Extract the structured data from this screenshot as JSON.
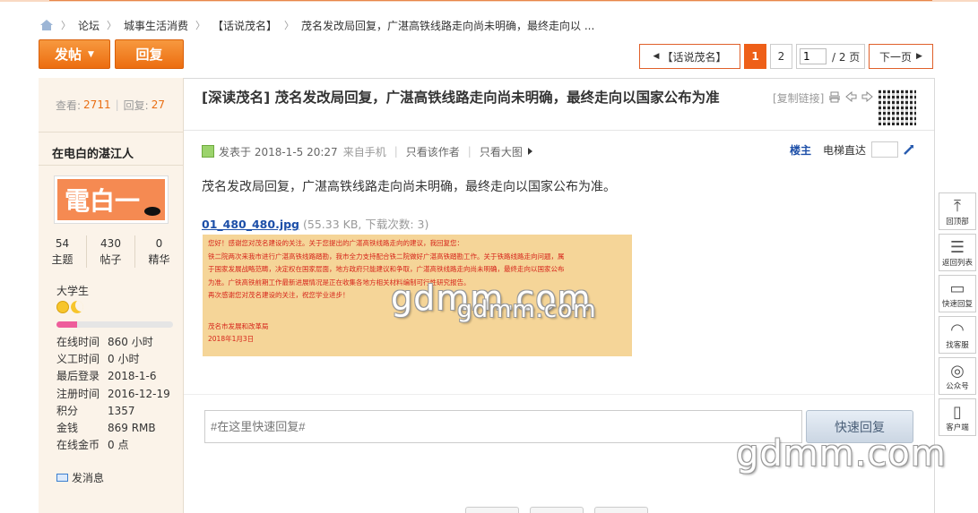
{
  "breadcrumb": {
    "items": [
      "论坛",
      "城事生活消费",
      "【话说茂名】",
      "茂名发改局回复，广湛高铁线路走向尚未明确，最终走向以 ..."
    ]
  },
  "actions": {
    "post": "发帖",
    "reply": "回复"
  },
  "pager": {
    "back": "【话说茂名】",
    "pages": [
      "1",
      "2"
    ],
    "current": "1",
    "input_value": "1",
    "total": "/ 2 页",
    "next": "下一页"
  },
  "thread": {
    "views_label": "查看:",
    "views": "2711",
    "replies_label": "回复:",
    "replies": "27",
    "title": "[深读茂名] 茂名发改局回复，广湛高铁线路走向尚未明确，最终走向以国家公布为准",
    "copy_link": "[复制链接]"
  },
  "author": {
    "name": "在电白的湛江人",
    "avatar_text": "電白一",
    "counts": [
      {
        "value": "54",
        "label": "主题"
      },
      {
        "value": "430",
        "label": "帖子"
      },
      {
        "value": "0",
        "label": "精华"
      }
    ],
    "rank": "大学生",
    "level_progress": 0.18,
    "info": [
      {
        "k": "在线时间",
        "v": "860 小时"
      },
      {
        "k": "义工时间",
        "v": "0 小时"
      },
      {
        "k": "最后登录",
        "v": "2018-1-6"
      },
      {
        "k": "注册时间",
        "v": "2016-12-19"
      },
      {
        "k": "积分",
        "v": "1357"
      },
      {
        "k": "金钱",
        "v": "869 RMB"
      },
      {
        "k": "在线金币",
        "v": "0 点"
      }
    ],
    "send_message": "发消息"
  },
  "post": {
    "posted": "发表于 2018-1-5 20:27",
    "source": "来自手机",
    "only_author": "只看该作者",
    "only_big": "只看大图",
    "floor": "楼主",
    "elevator": "电梯直达",
    "content": "茂名发改局回复，广湛高铁线路走向尚未明确，最终走向以国家公布为准。",
    "attachment_name": "01_480_480.jpg",
    "attachment_meta": "(55.33 KB, 下载次数: 3)",
    "image_lines": [
      "您好！感谢您对茂名建设的关注。关于您提出的广湛高铁线路走向的建议，我回复您：",
      "铁二院两次来我市进行广湛高铁线路踏勘，我市全力支持配合铁二院做好广湛高铁踏勘工作。关于铁路线路走向问题，属",
      "于国家发展战略范畴，决定权在国家层面，地方政府只能建议和争取，广湛高铁线路走向尚未明确，最终走向以国家公布",
      "为准。广铁高铁前期工作最新进展情况是正在收集各地方相关材料编制可行性研究报告。",
      "再次感谢您对茂名建设的关注，祝您学业进步！"
    ],
    "image_sig": "茂名市发展和改革局",
    "image_date": "2018年1月3日",
    "watermark": "gdmm.com"
  },
  "quick_reply": {
    "placeholder": "#在这里快速回复#",
    "button": "快速回复"
  },
  "side_toolbar": [
    {
      "label": "回顶部",
      "icon": "arrow-up-icon"
    },
    {
      "label": "返回列表",
      "icon": "list-icon"
    },
    {
      "label": "快速回复",
      "icon": "chat-icon"
    },
    {
      "label": "找客服",
      "icon": "headset-icon"
    },
    {
      "label": "公众号",
      "icon": "wechat-icon"
    },
    {
      "label": "客户端",
      "icon": "app-icon"
    }
  ]
}
